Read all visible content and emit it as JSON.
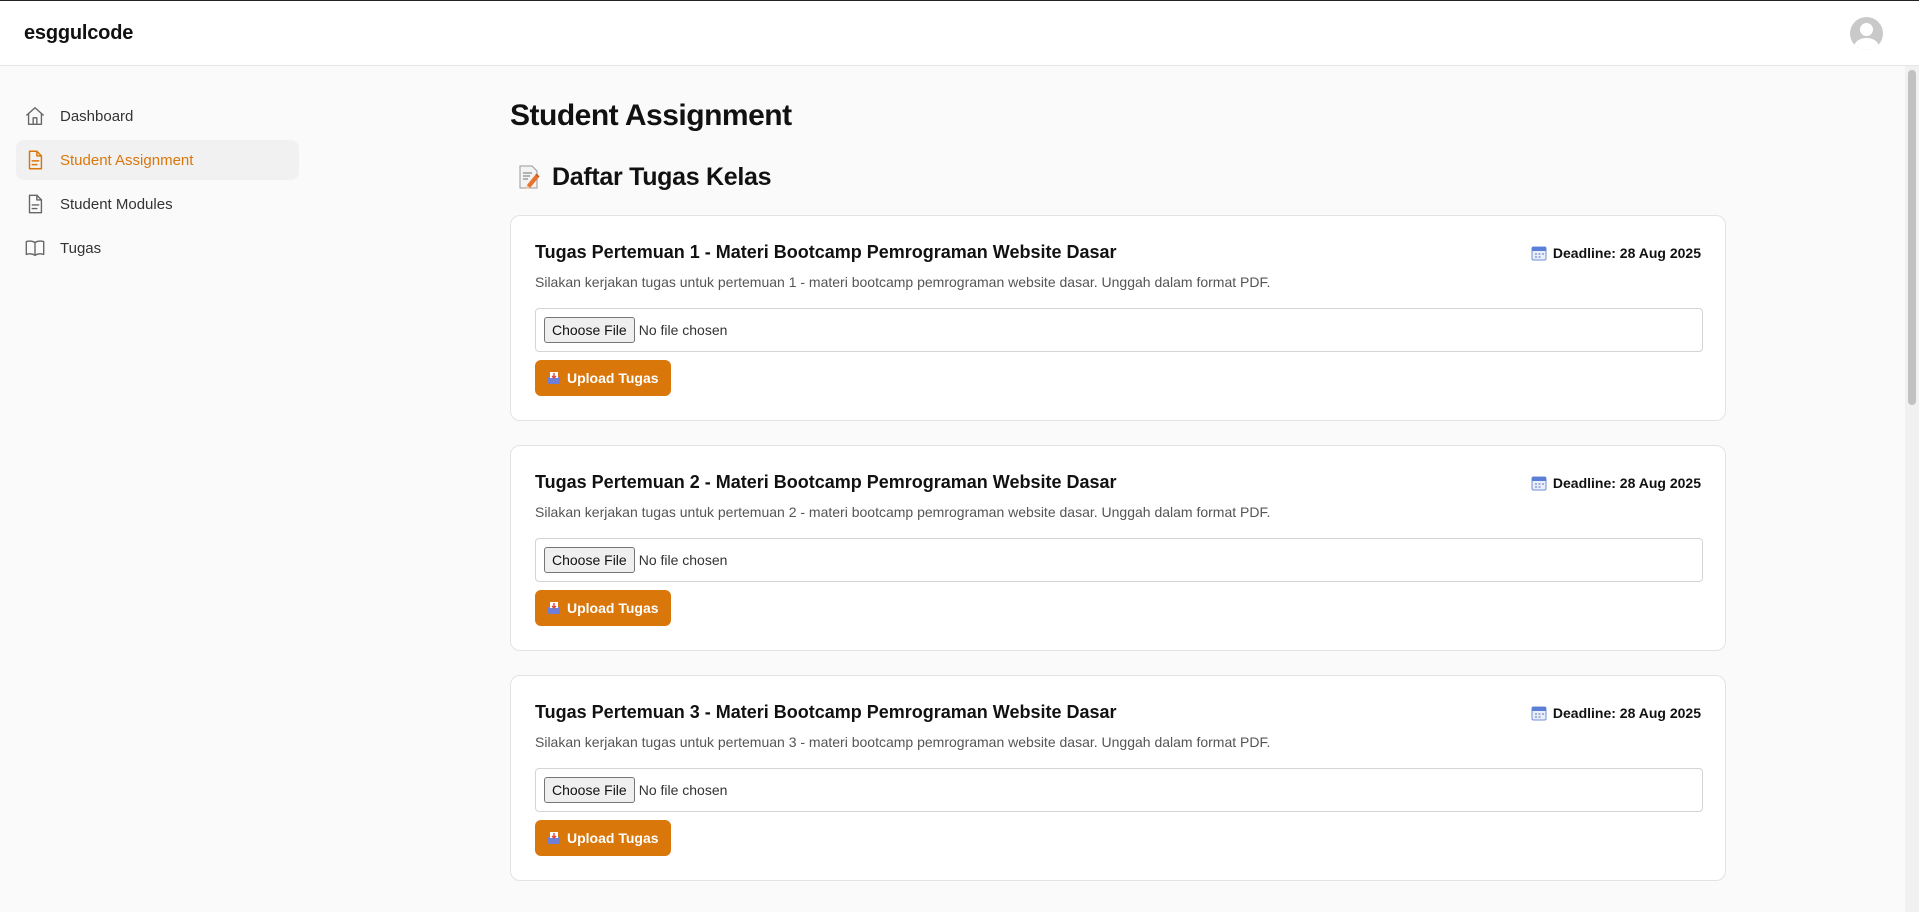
{
  "app": {
    "brand": "esggulcode"
  },
  "header": {
    "avatar_icon": "user-avatar-icon"
  },
  "sidebar": {
    "items": [
      {
        "label": "Dashboard",
        "icon": "home-icon",
        "active": false
      },
      {
        "label": "Student Assignment",
        "icon": "document-icon",
        "active": true
      },
      {
        "label": "Student Modules",
        "icon": "file-icon",
        "active": false
      },
      {
        "label": "Tugas",
        "icon": "book-icon",
        "active": false
      }
    ]
  },
  "main": {
    "title": "Student Assignment",
    "section_title": "Daftar Tugas Kelas",
    "section_icon": "memo-icon",
    "assignments": [
      {
        "title": "Tugas Pertemuan 1 - Materi Bootcamp Pemrograman Website Dasar",
        "deadline": "Deadline: 28 Aug 2025",
        "description": "Silakan kerjakan tugas untuk pertemuan 1 - materi bootcamp pemrograman website dasar. Unggah dalam format PDF.",
        "choose_file_label": "Choose File",
        "file_status": "No file chosen",
        "upload_label": "Upload Tugas"
      },
      {
        "title": "Tugas Pertemuan 2 - Materi Bootcamp Pemrograman Website Dasar",
        "deadline": "Deadline: 28 Aug 2025",
        "description": "Silakan kerjakan tugas untuk pertemuan 2 - materi bootcamp pemrograman website dasar. Unggah dalam format PDF.",
        "choose_file_label": "Choose File",
        "file_status": "No file chosen",
        "upload_label": "Upload Tugas"
      },
      {
        "title": "Tugas Pertemuan 3 - Materi Bootcamp Pemrograman Website Dasar",
        "deadline": "Deadline: 28 Aug 2025",
        "description": "Silakan kerjakan tugas untuk pertemuan 3 - materi bootcamp pemrograman website dasar. Unggah dalam format PDF.",
        "choose_file_label": "Choose File",
        "file_status": "No file chosen",
        "upload_label": "Upload Tugas"
      }
    ]
  },
  "colors": {
    "accent": "#d9770b",
    "background": "#fafafa",
    "card": "#ffffff",
    "border": "#e3e3e3"
  }
}
